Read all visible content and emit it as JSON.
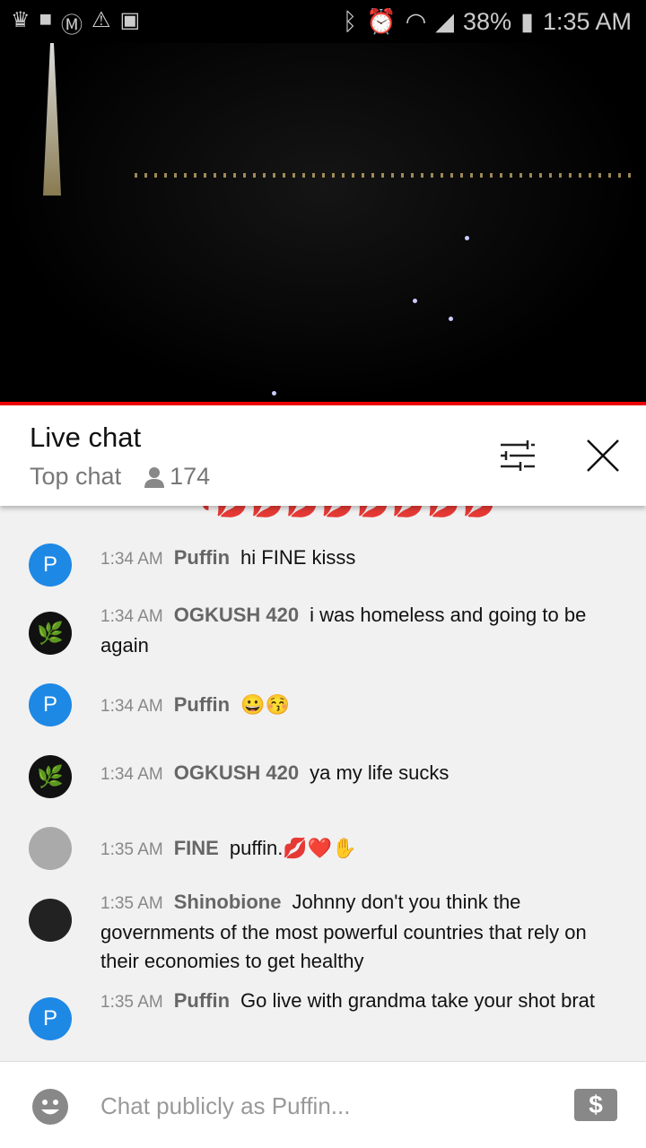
{
  "status_bar": {
    "battery": "38%",
    "time": "1:35 AM"
  },
  "header": {
    "title": "Live chat",
    "mode": "Top chat",
    "viewers": "174"
  },
  "messages": [
    {
      "time": "1:34 AM",
      "author": "Puffin",
      "text": "hi FINE kisss",
      "avatar": "P",
      "avatar_color": "#1e88e5"
    },
    {
      "time": "1:34 AM",
      "author": "OGKUSH 420",
      "text": "i was homeless and going to be again",
      "avatar": "🌿",
      "avatar_color": "#111111"
    },
    {
      "time": "1:34 AM",
      "author": "Puffin",
      "text": "😀😚",
      "avatar": "P",
      "avatar_color": "#1e88e5"
    },
    {
      "time": "1:34 AM",
      "author": "OGKUSH 420",
      "text": "ya my life sucks",
      "avatar": "🌿",
      "avatar_color": "#111111"
    },
    {
      "time": "1:35 AM",
      "author": "FINE",
      "text": "puffin.💋❤️✋",
      "avatar": "",
      "avatar_color": "#aaaaaa"
    },
    {
      "time": "1:35 AM",
      "author": "Shinobione",
      "text": "Johnny don't you think the governments of the most powerful countries that rely on their economies to get healthy",
      "avatar": "",
      "avatar_color": "#222222"
    },
    {
      "time": "1:35 AM",
      "author": "Puffin",
      "text": "Go live with grandma take your shot brat",
      "avatar": "P",
      "avatar_color": "#1e88e5"
    }
  ],
  "input": {
    "placeholder": "Chat publicly as Puffin..."
  }
}
